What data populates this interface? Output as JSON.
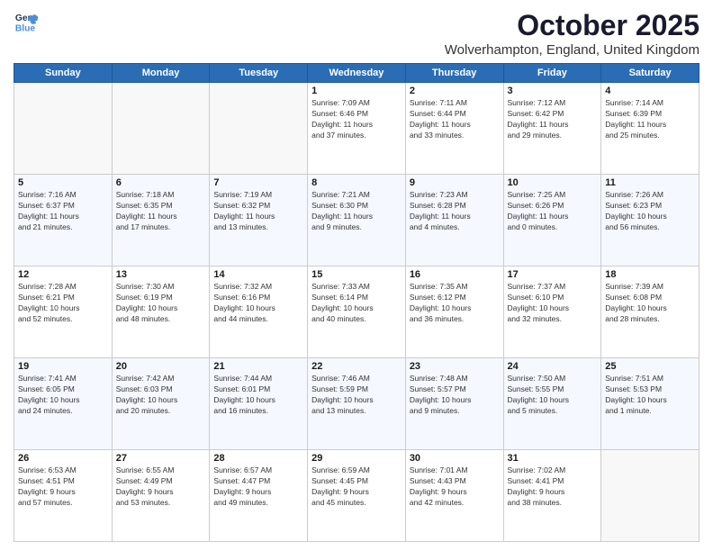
{
  "logo": {
    "line1": "General",
    "line2": "Blue"
  },
  "title": "October 2025",
  "location": "Wolverhampton, England, United Kingdom",
  "days_header": [
    "Sunday",
    "Monday",
    "Tuesday",
    "Wednesday",
    "Thursday",
    "Friday",
    "Saturday"
  ],
  "weeks": [
    [
      {
        "day": "",
        "info": ""
      },
      {
        "day": "",
        "info": ""
      },
      {
        "day": "",
        "info": ""
      },
      {
        "day": "1",
        "info": "Sunrise: 7:09 AM\nSunset: 6:46 PM\nDaylight: 11 hours\nand 37 minutes."
      },
      {
        "day": "2",
        "info": "Sunrise: 7:11 AM\nSunset: 6:44 PM\nDaylight: 11 hours\nand 33 minutes."
      },
      {
        "day": "3",
        "info": "Sunrise: 7:12 AM\nSunset: 6:42 PM\nDaylight: 11 hours\nand 29 minutes."
      },
      {
        "day": "4",
        "info": "Sunrise: 7:14 AM\nSunset: 6:39 PM\nDaylight: 11 hours\nand 25 minutes."
      }
    ],
    [
      {
        "day": "5",
        "info": "Sunrise: 7:16 AM\nSunset: 6:37 PM\nDaylight: 11 hours\nand 21 minutes."
      },
      {
        "day": "6",
        "info": "Sunrise: 7:18 AM\nSunset: 6:35 PM\nDaylight: 11 hours\nand 17 minutes."
      },
      {
        "day": "7",
        "info": "Sunrise: 7:19 AM\nSunset: 6:32 PM\nDaylight: 11 hours\nand 13 minutes."
      },
      {
        "day": "8",
        "info": "Sunrise: 7:21 AM\nSunset: 6:30 PM\nDaylight: 11 hours\nand 9 minutes."
      },
      {
        "day": "9",
        "info": "Sunrise: 7:23 AM\nSunset: 6:28 PM\nDaylight: 11 hours\nand 4 minutes."
      },
      {
        "day": "10",
        "info": "Sunrise: 7:25 AM\nSunset: 6:26 PM\nDaylight: 11 hours\nand 0 minutes."
      },
      {
        "day": "11",
        "info": "Sunrise: 7:26 AM\nSunset: 6:23 PM\nDaylight: 10 hours\nand 56 minutes."
      }
    ],
    [
      {
        "day": "12",
        "info": "Sunrise: 7:28 AM\nSunset: 6:21 PM\nDaylight: 10 hours\nand 52 minutes."
      },
      {
        "day": "13",
        "info": "Sunrise: 7:30 AM\nSunset: 6:19 PM\nDaylight: 10 hours\nand 48 minutes."
      },
      {
        "day": "14",
        "info": "Sunrise: 7:32 AM\nSunset: 6:16 PM\nDaylight: 10 hours\nand 44 minutes."
      },
      {
        "day": "15",
        "info": "Sunrise: 7:33 AM\nSunset: 6:14 PM\nDaylight: 10 hours\nand 40 minutes."
      },
      {
        "day": "16",
        "info": "Sunrise: 7:35 AM\nSunset: 6:12 PM\nDaylight: 10 hours\nand 36 minutes."
      },
      {
        "day": "17",
        "info": "Sunrise: 7:37 AM\nSunset: 6:10 PM\nDaylight: 10 hours\nand 32 minutes."
      },
      {
        "day": "18",
        "info": "Sunrise: 7:39 AM\nSunset: 6:08 PM\nDaylight: 10 hours\nand 28 minutes."
      }
    ],
    [
      {
        "day": "19",
        "info": "Sunrise: 7:41 AM\nSunset: 6:05 PM\nDaylight: 10 hours\nand 24 minutes."
      },
      {
        "day": "20",
        "info": "Sunrise: 7:42 AM\nSunset: 6:03 PM\nDaylight: 10 hours\nand 20 minutes."
      },
      {
        "day": "21",
        "info": "Sunrise: 7:44 AM\nSunset: 6:01 PM\nDaylight: 10 hours\nand 16 minutes."
      },
      {
        "day": "22",
        "info": "Sunrise: 7:46 AM\nSunset: 5:59 PM\nDaylight: 10 hours\nand 13 minutes."
      },
      {
        "day": "23",
        "info": "Sunrise: 7:48 AM\nSunset: 5:57 PM\nDaylight: 10 hours\nand 9 minutes."
      },
      {
        "day": "24",
        "info": "Sunrise: 7:50 AM\nSunset: 5:55 PM\nDaylight: 10 hours\nand 5 minutes."
      },
      {
        "day": "25",
        "info": "Sunrise: 7:51 AM\nSunset: 5:53 PM\nDaylight: 10 hours\nand 1 minute."
      }
    ],
    [
      {
        "day": "26",
        "info": "Sunrise: 6:53 AM\nSunset: 4:51 PM\nDaylight: 9 hours\nand 57 minutes."
      },
      {
        "day": "27",
        "info": "Sunrise: 6:55 AM\nSunset: 4:49 PM\nDaylight: 9 hours\nand 53 minutes."
      },
      {
        "day": "28",
        "info": "Sunrise: 6:57 AM\nSunset: 4:47 PM\nDaylight: 9 hours\nand 49 minutes."
      },
      {
        "day": "29",
        "info": "Sunrise: 6:59 AM\nSunset: 4:45 PM\nDaylight: 9 hours\nand 45 minutes."
      },
      {
        "day": "30",
        "info": "Sunrise: 7:01 AM\nSunset: 4:43 PM\nDaylight: 9 hours\nand 42 minutes."
      },
      {
        "day": "31",
        "info": "Sunrise: 7:02 AM\nSunset: 4:41 PM\nDaylight: 9 hours\nand 38 minutes."
      },
      {
        "day": "",
        "info": ""
      }
    ]
  ]
}
